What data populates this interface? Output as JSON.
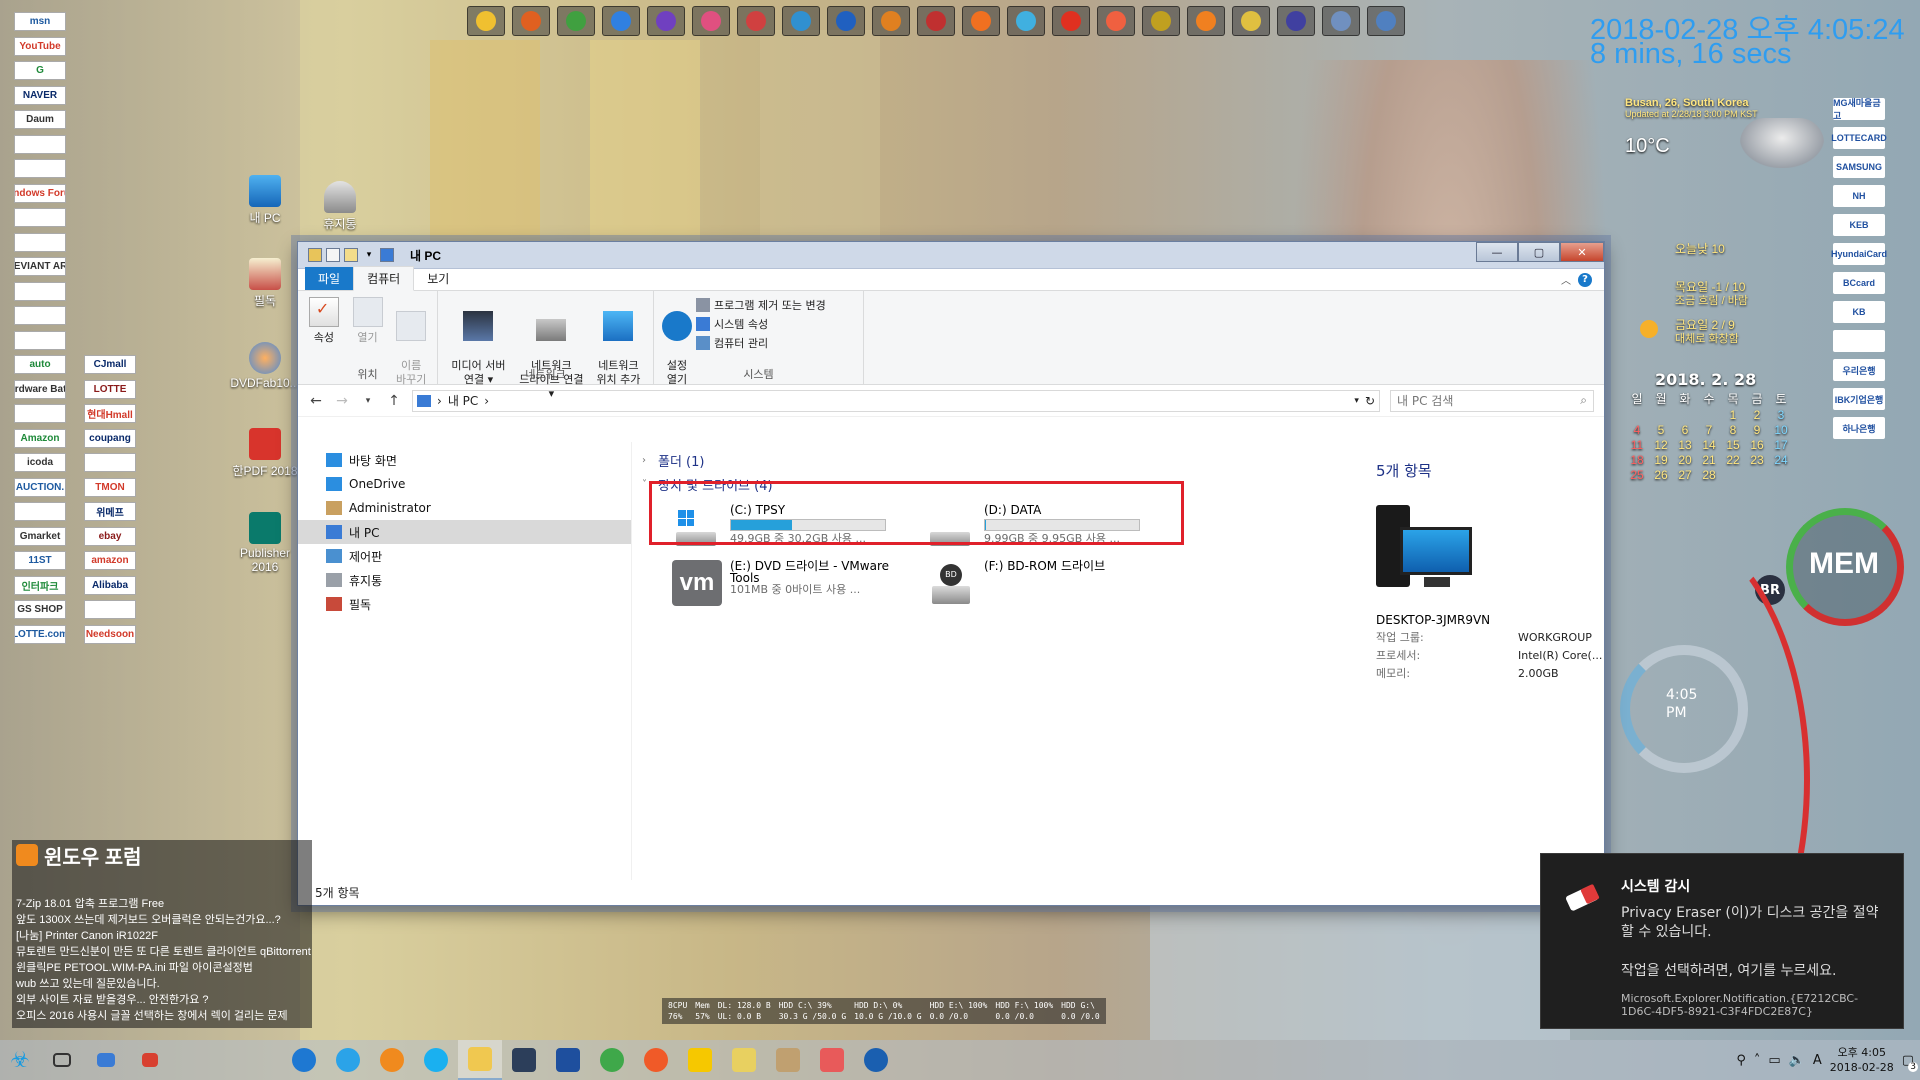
{
  "desktop": {
    "clock": {
      "datetime": "2018-02-28 오후 4:05:24",
      "uptime": "8 mins, 16 secs"
    },
    "weather": {
      "location": "Busan, 26, South Korea",
      "updated": "Updated at 2/28/18 3:00 PM KST",
      "temp": "10°C"
    },
    "forecast": [
      {
        "label": "오늘낮 10"
      },
      {
        "label": "목요일 -1 / 10",
        "sub": "조금 흐림 / 바람"
      },
      {
        "label": "금요일 2 / 9",
        "sub": "대체로 화창함"
      }
    ],
    "calendar": {
      "title": "2018. 2. 28",
      "headers": [
        "일",
        "월",
        "화",
        "수",
        "목",
        "금",
        "토"
      ],
      "days": [
        "",
        "",
        "",
        "",
        "1",
        "2",
        "3",
        "4",
        "5",
        "6",
        "7",
        "8",
        "9",
        "10",
        "11",
        "12",
        "13",
        "14",
        "15",
        "16",
        "17",
        "18",
        "19",
        "20",
        "21",
        "22",
        "23",
        "24",
        "25",
        "26",
        "27",
        "28",
        "",
        "",
        ""
      ]
    },
    "gauge": {
      "label": "MEM",
      "time": "4:05",
      "ampm": "PM",
      "br": "BR"
    },
    "icons": [
      {
        "label": "내 PC"
      },
      {
        "label": "휴지통"
      },
      {
        "label": "필독"
      },
      {
        "label": "DVDFab10..."
      },
      {
        "label": "한PDF 2018"
      },
      {
        "label": "Publisher 2016"
      }
    ],
    "left_links": [
      "msn",
      "YouTube",
      "G",
      "NAVER",
      "Daum",
      "",
      "",
      "Windows Forum",
      "",
      "",
      "DEVIANT ART",
      "",
      "",
      "",
      "auto",
      "CJmall",
      "Hardware Battle",
      "LOTTE",
      "",
      "현대Hmall",
      "Amazon",
      "coupang",
      "icoda",
      "",
      "AUCTION.",
      "TMON",
      "",
      "위메프",
      "Gmarket",
      "ebay",
      "11ST",
      "amazon",
      "인터파크",
      "Alibaba",
      "GS SHOP",
      "",
      "LOTTE.com",
      "Needsoon"
    ],
    "banks": [
      "MG새마을금고",
      "LOTTECARD",
      "SAMSUNG",
      "NH",
      "KEB",
      "HyundaiCard",
      "BCcard",
      "KB",
      "",
      "우리은행",
      "IBK기업은행",
      "하나은행"
    ],
    "colors": {
      "clock": "#2f9df0",
      "file_tab": "#1979ca",
      "highlight": "#e0202a",
      "drive_bar": "#26a0da"
    }
  },
  "explorer": {
    "title": "내 PC",
    "window_buttons": {
      "min": "—",
      "max": "▢",
      "close": "✕"
    },
    "tabs": [
      {
        "label": "파일",
        "kind": "file"
      },
      {
        "label": "컴퓨터",
        "kind": "active"
      },
      {
        "label": "보기",
        "kind": ""
      }
    ],
    "ribbon": {
      "location": {
        "label": "위치",
        "buttons": [
          "속성",
          "열기",
          "이름\n바꾸기"
        ]
      },
      "network": {
        "label": "네트워크",
        "buttons": [
          "미디어 서버\n연결 ▾",
          "네트워크\n드라이브 연결 ▾",
          "네트워크\n위치 추가"
        ]
      },
      "system": {
        "label": "시스템",
        "open_settings": "설정\n열기",
        "items": [
          "프로그램 제거 또는 변경",
          "시스템 속성",
          "컴퓨터 관리"
        ]
      }
    },
    "address": {
      "path": "내 PC",
      "search_placeholder": "내 PC 검색"
    },
    "nav": [
      {
        "label": "바탕 화면",
        "icon": "desktop-icon"
      },
      {
        "label": "OneDrive",
        "icon": "onedrive-icon"
      },
      {
        "label": "Administrator",
        "icon": "user-icon"
      },
      {
        "label": "내 PC",
        "icon": "pc-icon",
        "selected": true
      },
      {
        "label": "제어판",
        "icon": "control-panel-icon"
      },
      {
        "label": "휴지통",
        "icon": "recycle-bin-icon"
      },
      {
        "label": "필독",
        "icon": "folder-icon"
      }
    ],
    "groups": {
      "folders": "폴더 (1)",
      "devices": "장치 및 드라이브 (4)"
    },
    "drives": [
      {
        "name": "(C:) TPSY",
        "usage": "49.9GB 중 30.2GB 사용 ...",
        "used_fraction": 0.395,
        "icon": "windows-drive-icon"
      },
      {
        "name": "(D:) DATA",
        "usage": "9.99GB 중 9.95GB 사용 ...",
        "used_fraction": 0.004,
        "icon": "hard-drive-icon"
      },
      {
        "name": "(E:) DVD 드라이브 - VMware Tools",
        "usage": "101MB 중 0바이트 사용 ...",
        "icon": "vmware-icon"
      },
      {
        "name": "(F:) BD-ROM 드라이브",
        "usage": "",
        "icon": "bd-rom-icon"
      }
    ],
    "details": {
      "count": "5개 항목",
      "pc_name": "DESKTOP-3JMR9VN",
      "props": [
        {
          "k": "작업 그룹:",
          "v": "WORKGROUP"
        },
        {
          "k": "프로세서:",
          "v": "Intel(R) Core(..."
        },
        {
          "k": "메모리:",
          "v": "2.00GB"
        }
      ]
    },
    "status": "5개 항목"
  },
  "forum": {
    "title": "윈도우 포럼",
    "items": [
      "7-Zip 18.01 압축 프로그램 Free",
      "앞도 1300X 쓰는데 제거보드 오버클럭은 안되는건가요...?",
      "[나눔] Printer Canon iR1022F",
      "뮤토렌트 만드신분이 만든 또 다른 토렌트 클라이언트 qBittorrent",
      "윈클릭PE PETOOL.WIM-PA.ini 파일 아이콘설정법",
      "wub 쓰고 있는데 질문있습니다.",
      "외부 사이트 자료 받을경우... 안전한가요 ?",
      "오피스 2016 사용시 글꼴 선택하는 창에서 렉이 걸리는 문제"
    ]
  },
  "sysmon": [
    {
      "a": "8CPU",
      "b": "76%"
    },
    {
      "a": "Mem",
      "b": "57%"
    },
    {
      "a": "DL: 128.0 B",
      "b": "UL: 0.0 B"
    },
    {
      "a": "HDD C:\\ 39%",
      "b": "30.3 G /50.0 G"
    },
    {
      "a": "HDD D:\\ 0%",
      "b": "10.0 G /10.0 G"
    },
    {
      "a": "HDD E:\\ 100%",
      "b": "0.0 /0.0"
    },
    {
      "a": "HDD F:\\ 100%",
      "b": "0.0 /0.0"
    },
    {
      "a": "HDD G:\\",
      "b": "0.0 /0.0"
    }
  ],
  "toast": {
    "title": "시스템 감시",
    "message": "Privacy Eraser (이)가 디스크 공간을 절약할 수 있습니다.",
    "cta": "작업을 선택하려면, 여기를 누르세요.",
    "source": "Microsoft.Explorer.Notification.{E7212CBC-1D6C-4DF5-8921-C3F4FDC2E87C}"
  },
  "taskbar": {
    "time": "오후 4:05",
    "date": "2018-02-28",
    "lang": "A",
    "notif_count": "3"
  }
}
